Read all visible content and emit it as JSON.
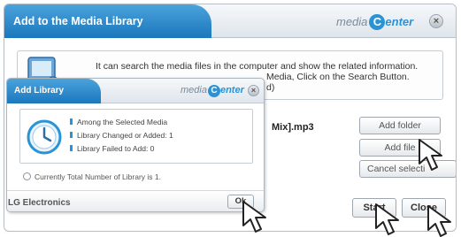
{
  "main_window": {
    "title": "Add to the Media Library",
    "brand": {
      "prefix": "media",
      "c_letter": "C",
      "rest": "enter"
    },
    "close_symbol": "×",
    "info_line1": "It can search the media files in the computer and show the related information.",
    "info_line2": "Media, Click on the Search Button.",
    "info_line2_partial": "d)",
    "file_name": "Mix].mp3",
    "buttons": {
      "add_folder": "Add folder",
      "add_file": "Add file",
      "cancel_selection": "Cancel selecti",
      "start": "Start",
      "close": "Close"
    },
    "icons": [
      "monitor-icon",
      "close-icon"
    ]
  },
  "sub_window": {
    "title": "Add Library",
    "brand": {
      "prefix": "media",
      "c_letter": "C",
      "rest": "enter"
    },
    "close_symbol": "×",
    "results": [
      "Among the Selected Media",
      "Library Changed or Added: 1",
      "Library Failed to Add: 0"
    ],
    "total_text": "Currently Total Number of Library is 1.",
    "footer": "LG Electronics",
    "ok_button": "Ok",
    "icons": [
      "clock-icon",
      "radio-icon"
    ]
  },
  "colors": {
    "accent_blue": "#1b77bd",
    "accent_light_blue": "#4ba3db",
    "border_gray": "#b5bcc6"
  }
}
